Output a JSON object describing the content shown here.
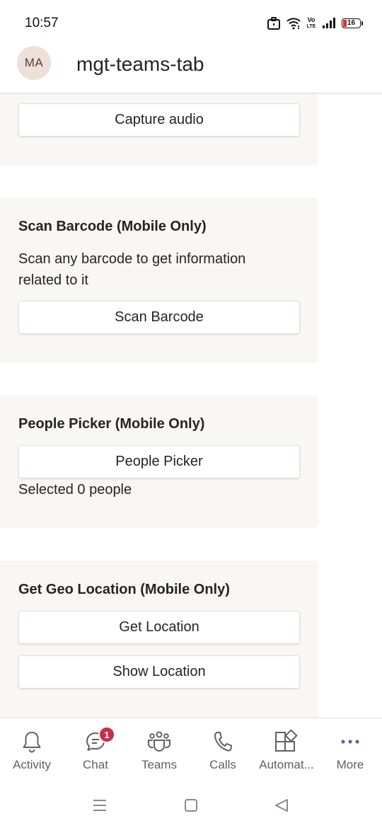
{
  "status_bar": {
    "time": "10:57",
    "volte_top": "Vo",
    "volte_bottom": "LTE",
    "battery_level": "16"
  },
  "header": {
    "avatar_initials": "MA",
    "title": "mgt-teams-tab"
  },
  "cards": {
    "capture_audio": {
      "button_label": "Capture audio"
    },
    "scan_barcode": {
      "title": "Scan Barcode (Mobile Only)",
      "description": "Scan any barcode to get information related to it",
      "button_label": "Scan Barcode"
    },
    "people_picker": {
      "title": "People Picker (Mobile Only)",
      "button_label": "People Picker",
      "selected_text": "Selected 0 people"
    },
    "geo_location": {
      "title": "Get Geo Location (Mobile Only)",
      "get_button_label": "Get Location",
      "show_button_label": "Show Location"
    }
  },
  "bottom_nav": {
    "items": [
      {
        "label": "Activity",
        "icon": "bell-icon"
      },
      {
        "label": "Chat",
        "icon": "chat-icon",
        "badge": "1"
      },
      {
        "label": "Teams",
        "icon": "teams-icon"
      },
      {
        "label": "Calls",
        "icon": "phone-icon"
      },
      {
        "label": "Automat...",
        "icon": "apps-icon"
      },
      {
        "label": "More",
        "icon": "more-dots-icon"
      }
    ]
  },
  "colors": {
    "card_background": "#f9f7f6",
    "badge": "#c4314b",
    "accent": "#6264a7",
    "avatar_background": "#efdfd9"
  }
}
